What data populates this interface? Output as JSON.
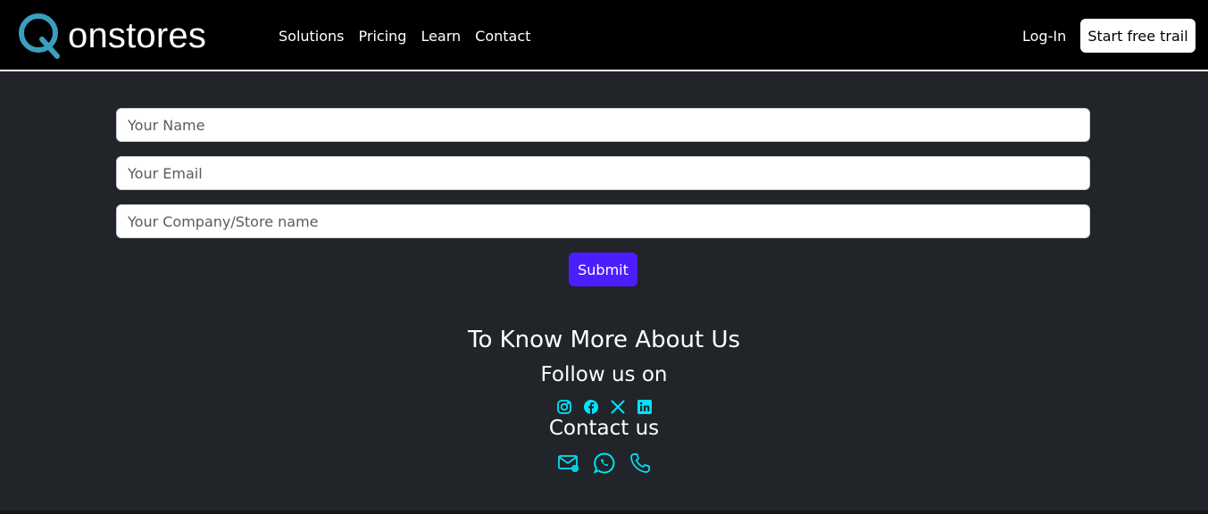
{
  "brand": {
    "name": "onstores",
    "accent_color": "#3a9fbf"
  },
  "nav": {
    "links": [
      "Solutions",
      "Pricing",
      "Learn",
      "Contact"
    ],
    "login_label": "Log-In",
    "trial_label": "Start free trail"
  },
  "form": {
    "heading_partial": "",
    "name_placeholder": "Your Name",
    "email_placeholder": "Your Email",
    "company_placeholder": "Your Company/Store name",
    "submit_label": "Submit",
    "submit_color": "#4c1dff"
  },
  "about": {
    "title": "To Know More About Us",
    "follow_title": "Follow us on",
    "social_icons": [
      "instagram-icon",
      "facebook-icon",
      "x-icon",
      "linkedin-icon"
    ],
    "contact_title": "Contact us",
    "contact_icons": [
      "email-icon",
      "whatsapp-icon",
      "phone-icon"
    ],
    "icon_color": "#00e5ff"
  }
}
